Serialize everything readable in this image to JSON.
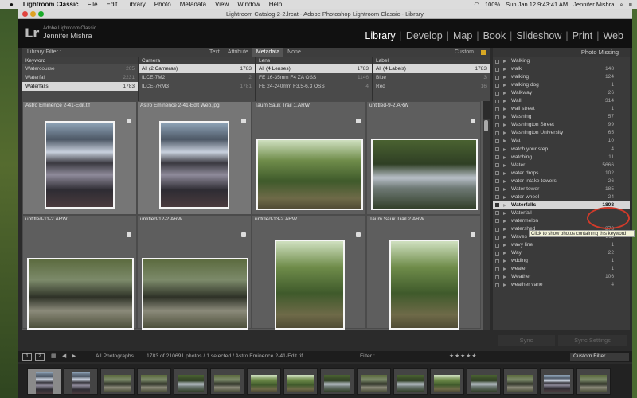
{
  "menubar": {
    "apple": "",
    "app": "Lightroom Classic",
    "items": [
      "File",
      "Edit",
      "Library",
      "Photo",
      "Metadata",
      "View",
      "Window",
      "Help"
    ],
    "battery": "100%",
    "clock": "Sun Jan 12  9:43:41 AM",
    "user": "Jennifer Mishra"
  },
  "window": {
    "title": "Lightroom Catalog-2-2.lrcat - Adobe Photoshop Lightroom Classic - Library"
  },
  "identity": {
    "logo": "Lr",
    "subtitle": "Adobe Lightroom Classic",
    "name": "Jennifer Mishra"
  },
  "modules": [
    "Library",
    "Develop",
    "Map",
    "Book",
    "Slideshow",
    "Print",
    "Web"
  ],
  "filter": {
    "label": "Library Filter :",
    "tabs": [
      "Text",
      "Attribute",
      "Metadata",
      "None"
    ],
    "selected": "Metadata",
    "custom": "Custom"
  },
  "browser": [
    {
      "header": "Keyword",
      "rows": [
        {
          "name": "Watercourse",
          "count": "205"
        },
        {
          "name": "Waterfall",
          "count": "2231"
        },
        {
          "name": "Waterfalls",
          "count": "1783",
          "sel": true
        }
      ]
    },
    {
      "header": "Camera",
      "rows": [
        {
          "name": "All (2 Cameras)",
          "count": "1783",
          "sel": true
        },
        {
          "name": "ILCE-7M2",
          "count": "2"
        },
        {
          "name": "ILCE-7RM3",
          "count": "1781"
        }
      ]
    },
    {
      "header": "Lens",
      "rows": [
        {
          "name": "All (4 Lenses)",
          "count": "1783",
          "sel": true
        },
        {
          "name": "FE 16-35mm F4 ZA OSS",
          "count": "1146"
        },
        {
          "name": "FE 24-240mm F3.5-6.3 OSS",
          "count": "4"
        }
      ]
    },
    {
      "header": "Label",
      "rows": [
        {
          "name": "All (4 Labels)",
          "count": "1783",
          "sel": true
        },
        {
          "name": "Blue",
          "count": "3"
        },
        {
          "name": "Red",
          "count": "16"
        }
      ]
    }
  ],
  "grid": [
    {
      "file": "Astro Eminence 2-41-Edit.tif",
      "img": "water"
    },
    {
      "file": "Astro Eminence 2-41-Edit Web.jpg",
      "img": "water"
    },
    {
      "file": "Taum Sauk Trail 1.ARW",
      "img": "forest"
    },
    {
      "file": "untitled-9-2.ARW",
      "img": "creek"
    },
    {
      "file": "untitled-11-2.ARW",
      "img": "stone"
    },
    {
      "file": "untitled-12-2.ARW",
      "img": "stone"
    },
    {
      "file": "untitled-13-2.ARW",
      "img": "forest"
    },
    {
      "file": "Taum Sauk Trail 2.ARW",
      "img": "forest"
    }
  ],
  "panel": {
    "header": "Photo Missing"
  },
  "keywords": [
    {
      "name": "Walking",
      "count": ""
    },
    {
      "name": "walk",
      "count": "148"
    },
    {
      "name": "walking",
      "count": "124"
    },
    {
      "name": "walking dog",
      "count": "1"
    },
    {
      "name": "Walkway",
      "count": "26"
    },
    {
      "name": "Wall",
      "count": "314"
    },
    {
      "name": "wall street",
      "count": "1"
    },
    {
      "name": "Washing",
      "count": "57"
    },
    {
      "name": "Washington Street",
      "count": "99"
    },
    {
      "name": "Washington University",
      "count": "65"
    },
    {
      "name": "Wat",
      "count": "10"
    },
    {
      "name": "watch your step",
      "count": "4"
    },
    {
      "name": "watching",
      "count": "11"
    },
    {
      "name": "Water",
      "count": "5666"
    },
    {
      "name": "water drops",
      "count": "102"
    },
    {
      "name": "water intake towers",
      "count": "26"
    },
    {
      "name": "Water tower",
      "count": "185"
    },
    {
      "name": "water wheel",
      "count": "24"
    },
    {
      "name": "Waterfalls",
      "count": "1808",
      "sel": true
    },
    {
      "name": "Waterfall",
      "count": ""
    },
    {
      "name": "watermelon",
      "count": ""
    },
    {
      "name": "watershed",
      "count": "373"
    },
    {
      "name": "Waves",
      "count": "211"
    },
    {
      "name": "wavy line",
      "count": "1"
    },
    {
      "name": "Way",
      "count": "22"
    },
    {
      "name": "wdding",
      "count": "1"
    },
    {
      "name": "weater",
      "count": "1"
    },
    {
      "name": "Weather",
      "count": "106"
    },
    {
      "name": "weather vane",
      "count": "4"
    }
  ],
  "tooltip": "Click to show photos containing this keyword",
  "buttons": {
    "sync": "Sync",
    "settings": "Sync Settings"
  },
  "toolbar": {
    "p1": "1",
    "p2": "2",
    "source": "All Photographs",
    "info": "1783 of 210691 photos / 1 selected / Astro Eminence 2-41-Edit.tif",
    "filter": "Filter :",
    "custom": "Custom Filter"
  },
  "filmstrip": {
    "count": 16
  }
}
